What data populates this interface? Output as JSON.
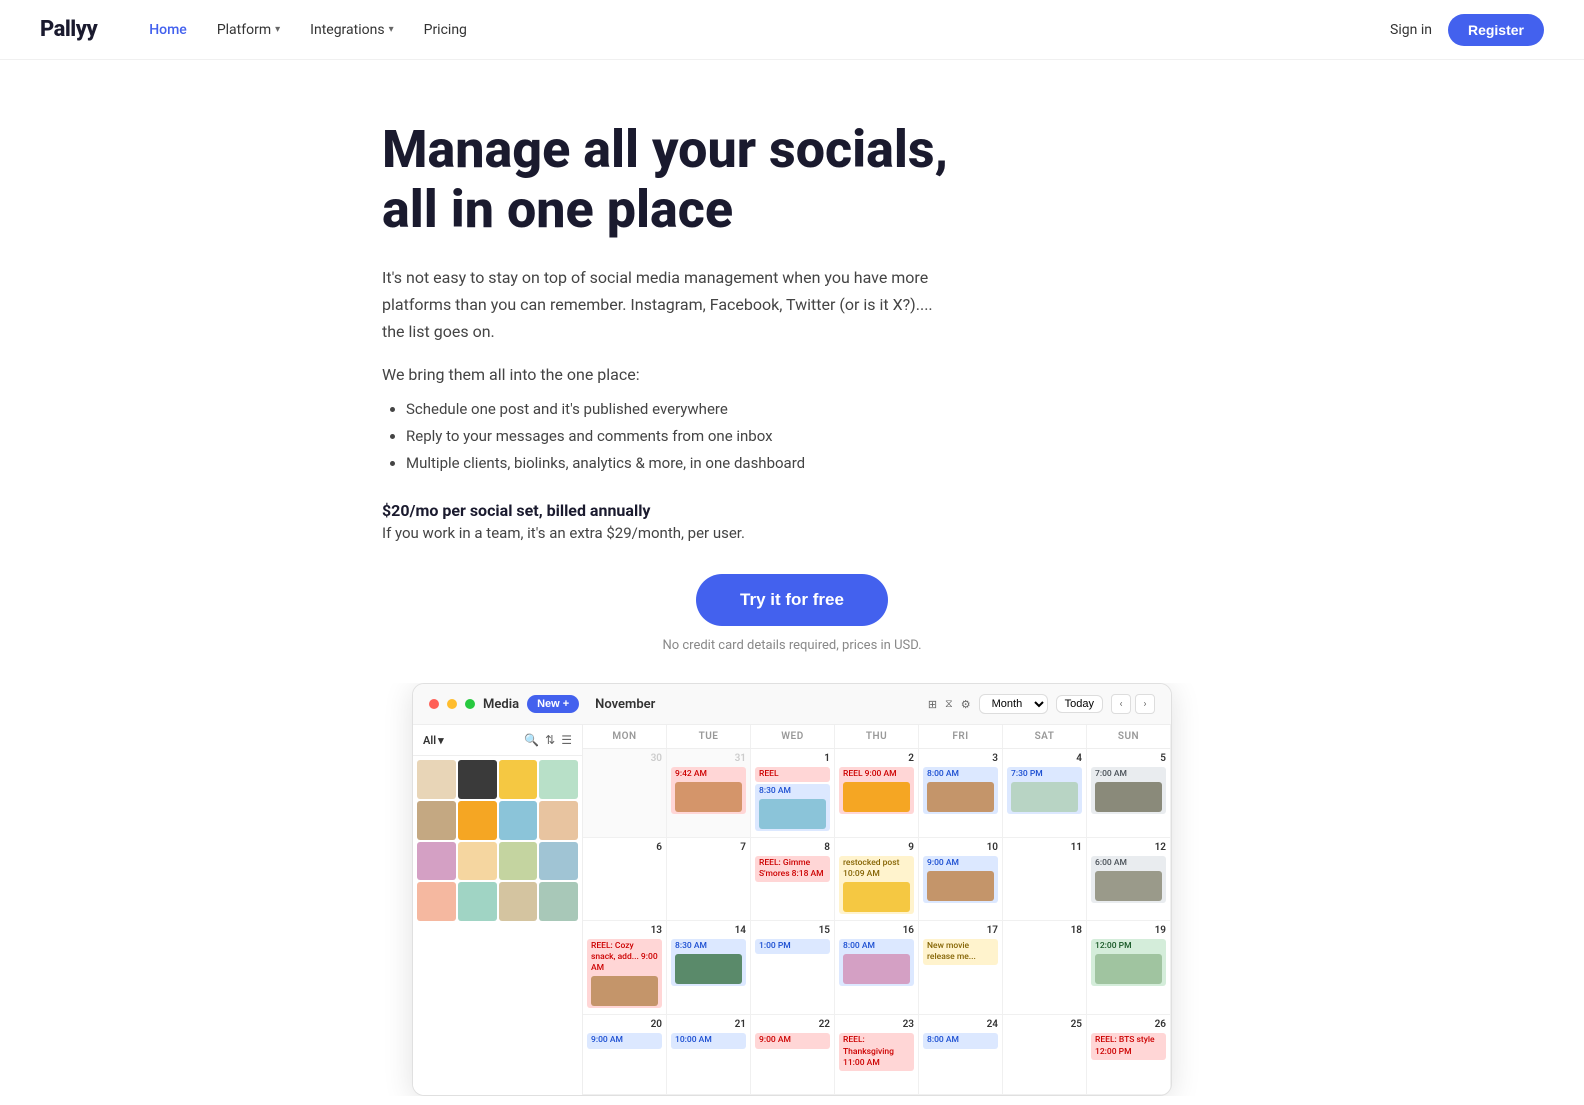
{
  "brand": {
    "name": "Pallyy",
    "logo_text": "Pallyy"
  },
  "nav": {
    "links": [
      {
        "label": "Home",
        "active": true,
        "has_dropdown": false
      },
      {
        "label": "Platform",
        "active": false,
        "has_dropdown": true
      },
      {
        "label": "Integrations",
        "active": false,
        "has_dropdown": true
      },
      {
        "label": "Pricing",
        "active": false,
        "has_dropdown": false
      }
    ],
    "sign_in": "Sign in",
    "register": "Register"
  },
  "hero": {
    "title": "Manage all your socials, all in one place",
    "description": "It's not easy to stay on top of social media management when you have more platforms than you can remember. Instagram, Facebook, Twitter (or is it X?).... the list goes on.",
    "bring_label": "We bring them all into the one place:",
    "bullets": [
      "Schedule one post and it's published everywhere",
      "Reply to your messages and comments from one inbox",
      "Multiple clients, biolinks, analytics & more, in one dashboard"
    ],
    "pricing_main": "$20/mo per social set, billed annually",
    "pricing_sub": "If you work in a team, it's an extra $29/month, per user.",
    "cta_label": "Try it for free",
    "cta_note": "No credit card details required, prices in USD."
  },
  "dashboard": {
    "header": {
      "media_label": "Media",
      "new_label": "New +",
      "month_label": "November",
      "controls": [
        "grid-icon",
        "filter-icon",
        "settings-icon"
      ],
      "month_select": "Month",
      "today_btn": "Today",
      "prev_arrow": "‹",
      "next_arrow": "›"
    },
    "sidebar": {
      "filter_label": "All",
      "thumbnail_colors": [
        "#e8d5b7",
        "#3a3a3a",
        "#f5c842",
        "#b8e0c8",
        "#c4a882",
        "#f5a623",
        "#8bc4d9",
        "#e8c4a0",
        "#d4a0c4",
        "#f5d6a0",
        "#c4d4a0",
        "#a0c4d4",
        "#f5b8a0",
        "#a0d4c4",
        "#d4c4a0",
        "#a8c8b8"
      ]
    },
    "calendar": {
      "days": [
        "MON",
        "TUE",
        "WED",
        "THU",
        "FRI",
        "SAT",
        "SUN"
      ],
      "weeks": [
        {
          "cells": [
            {
              "num": "30",
              "dimmed": true,
              "events": []
            },
            {
              "num": "31",
              "dimmed": true,
              "events": [
                {
                  "type": "pink",
                  "label": "9:42 AM",
                  "has_thumb": true,
                  "thumb_color": "#d4956a"
                }
              ]
            },
            {
              "num": "1",
              "events": [
                {
                  "type": "pink",
                  "label": "REEL"
                },
                {
                  "type": "blue",
                  "label": "8:30 AM",
                  "has_thumb": true,
                  "thumb_color": "#8bc4d9"
                }
              ]
            },
            {
              "num": "2",
              "events": [
                {
                  "type": "pink",
                  "label": "REEL\n9:00 AM",
                  "has_thumb": true,
                  "thumb_color": "#f5a623"
                }
              ]
            },
            {
              "num": "3",
              "events": [
                {
                  "type": "blue",
                  "label": "8:00 AM",
                  "has_thumb": true,
                  "thumb_color": "#c4956a"
                }
              ]
            },
            {
              "num": "4",
              "events": [
                {
                  "type": "blue",
                  "label": "7:30 PM",
                  "has_thumb": true,
                  "thumb_color": "#b8d4c4"
                }
              ]
            },
            {
              "num": "5",
              "events": [
                {
                  "type": "gray",
                  "label": "7:00 AM",
                  "has_thumb": true,
                  "thumb_color": "#8a8a7a"
                }
              ]
            }
          ]
        },
        {
          "cells": [
            {
              "num": "6",
              "events": []
            },
            {
              "num": "7",
              "events": []
            },
            {
              "num": "8",
              "events": [
                {
                  "type": "pink",
                  "label": "REEL: Gimme S'mores\n8:18 AM"
                }
              ]
            },
            {
              "num": "9",
              "events": [
                {
                  "type": "yellow",
                  "label": "restocked post\n10:09 AM",
                  "has_thumb": true,
                  "thumb_color": "#f5c842"
                }
              ]
            },
            {
              "num": "10",
              "events": [
                {
                  "type": "blue",
                  "label": "9:00 AM",
                  "has_thumb": true,
                  "thumb_color": "#c4956a"
                }
              ]
            },
            {
              "num": "11",
              "events": []
            },
            {
              "num": "12",
              "events": [
                {
                  "type": "gray",
                  "label": "6:00 AM",
                  "has_thumb": true,
                  "thumb_color": "#9a9a8a"
                }
              ]
            }
          ]
        },
        {
          "cells": [
            {
              "num": "13",
              "events": [
                {
                  "type": "pink",
                  "label": "REEL: Cozy snack, add...\n9:00 AM",
                  "has_thumb": true,
                  "thumb_color": "#c4956a"
                }
              ]
            },
            {
              "num": "14",
              "events": [
                {
                  "type": "blue",
                  "label": "8:30 AM",
                  "has_thumb": true,
                  "thumb_color": "#5a8a6a"
                }
              ]
            },
            {
              "num": "15",
              "events": [
                {
                  "type": "blue",
                  "label": "1:00 PM"
                }
              ]
            },
            {
              "num": "16",
              "events": [
                {
                  "type": "blue",
                  "label": "8:00 AM",
                  "has_thumb": true,
                  "thumb_color": "#d4a0c4"
                }
              ]
            },
            {
              "num": "17",
              "events": [
                {
                  "type": "yellow",
                  "label": "New movie release me..."
                }
              ]
            },
            {
              "num": "18",
              "events": []
            },
            {
              "num": "19",
              "events": [
                {
                  "type": "green",
                  "label": "12:00 PM",
                  "has_thumb": true,
                  "thumb_color": "#a0c4a0"
                }
              ]
            }
          ]
        },
        {
          "cells": [
            {
              "num": "20",
              "events": [
                {
                  "type": "blue",
                  "label": "9:00 AM"
                }
              ]
            },
            {
              "num": "21",
              "events": [
                {
                  "type": "blue",
                  "label": "10:00 AM"
                }
              ]
            },
            {
              "num": "22",
              "events": [
                {
                  "type": "pink",
                  "label": "9:00 AM"
                }
              ]
            },
            {
              "num": "23",
              "events": [
                {
                  "type": "pink",
                  "label": "REEL: Thanksgiving\n11:00 AM"
                }
              ]
            },
            {
              "num": "24",
              "events": [
                {
                  "type": "blue",
                  "label": "8:00 AM"
                }
              ]
            },
            {
              "num": "25",
              "events": []
            },
            {
              "num": "26",
              "events": [
                {
                  "type": "pink",
                  "label": "REEL: BTS style\n12:00 PM"
                }
              ]
            }
          ]
        }
      ]
    }
  }
}
